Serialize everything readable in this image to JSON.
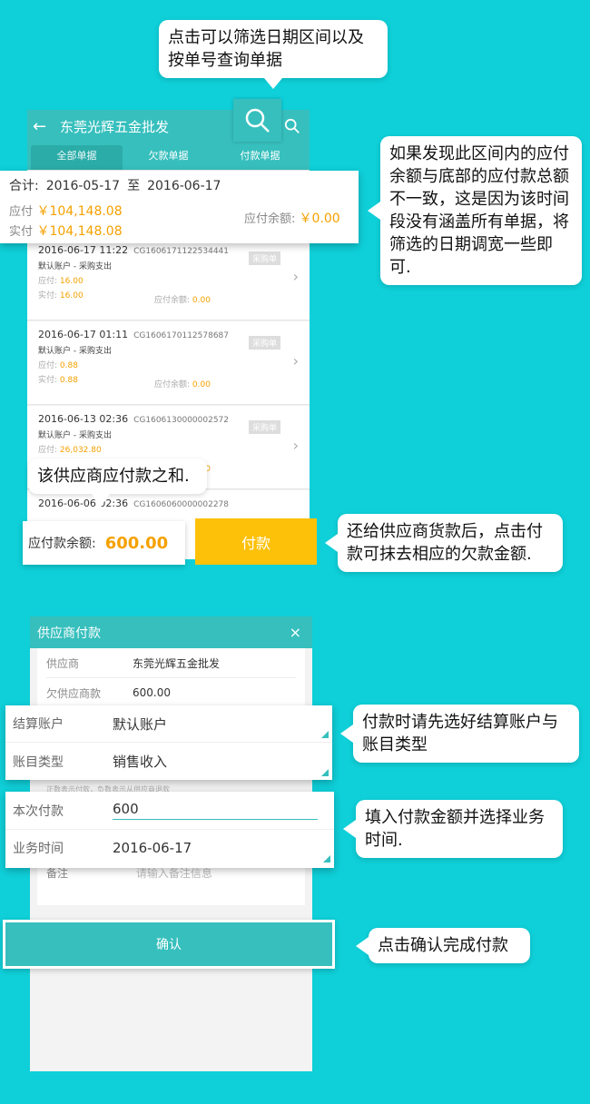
{
  "tips": {
    "search": "点击可以筛选日期区间以及按单号查询单据",
    "mismatch": "如果发现此区间内的应付余额与底部的应付款总额不一致，这是因为该时间段没有涵盖所有单据，将筛选的日期调宽一些即可.",
    "sum": "该供应商应付款之和.",
    "pay": "还给供应商货款后，点击付款可抹去相应的欠款金额.",
    "account": "付款时请先选好结算账户与账目类型",
    "amount": "填入付款金额并选择业务时间.",
    "confirm": "点击确认完成付款"
  },
  "screen1": {
    "title": "东莞光辉五金批发",
    "tabs": [
      "全部单据",
      "欠款单据",
      "付款单据"
    ],
    "summary": {
      "label": "合计:",
      "from": "2016-05-17",
      "to_word": "至",
      "to": "2016-06-17",
      "payable_label": "应付",
      "payable": "￥104,148.08",
      "paid_label": "实付",
      "paid": "￥104,148.08",
      "balance_label": "应付余额:",
      "balance": "￥0.00"
    },
    "records": [
      {
        "time": "2016-06-17 11:22",
        "code": "CG1606171122534441",
        "account": "默认账户  -  采购支出",
        "payable": "16.00",
        "paid": "16.00",
        "balance": "0.00",
        "badge": "采购单"
      },
      {
        "time": "2016-06-17 01:11",
        "code": "CG1606170112578687",
        "account": "默认账户  -  采购支出",
        "payable": "0.88",
        "paid": "0.88",
        "balance": "0.00",
        "badge": "采购单"
      },
      {
        "time": "2016-06-13 02:36",
        "code": "CG1606130000002572",
        "account": "默认账户  -  采购支出",
        "payable": "26,032.80",
        "paid": "",
        "balance": "0.00",
        "badge": "采购单"
      },
      {
        "time": "2016-06-06 02:36",
        "code": "CG1606060000002278",
        "account": "",
        "payable": "",
        "paid": "",
        "balance": "",
        "badge": ""
      }
    ],
    "record_labels": {
      "payable": "应付:",
      "paid": "实付:",
      "balance": "应付余额:"
    },
    "bottom": {
      "balance_label": "应付款余额:",
      "balance": "600.00",
      "pay_button": "付款"
    }
  },
  "screen2": {
    "title": "供应商付款",
    "close": "×",
    "supplier_label": "供应商",
    "supplier": "东莞光辉五金批发",
    "owed_label": "欠供应商款",
    "owed": "600.00",
    "account_label": "结算账户",
    "account": "默认账户",
    "type_label": "账目类型",
    "type": "销售收入",
    "hint": "正数表示付款，负数表示从供应商退款",
    "amount_label": "本次付款",
    "amount": "600",
    "date_label": "业务时间",
    "date": "2016-06-17",
    "note_label": "备注",
    "note_placeholder": "请输入备注信息",
    "confirm": "确认"
  }
}
